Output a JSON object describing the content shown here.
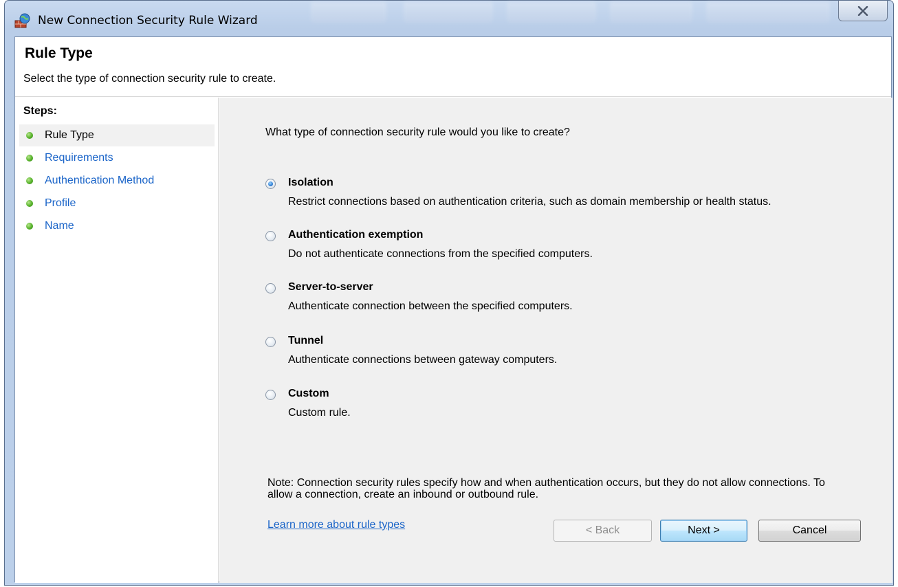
{
  "window": {
    "title": "New Connection Security Rule Wizard",
    "close_symbol": "✕"
  },
  "header": {
    "title": "Rule Type",
    "subtitle": "Select the type of connection security rule to create."
  },
  "steps": {
    "title": "Steps:",
    "items": [
      {
        "label": "Rule Type",
        "active": true
      },
      {
        "label": "Requirements",
        "active": false
      },
      {
        "label": "Authentication Method",
        "active": false
      },
      {
        "label": "Profile",
        "active": false
      },
      {
        "label": "Name",
        "active": false
      }
    ]
  },
  "main": {
    "question": "What type of connection security rule would you like to create?",
    "options": [
      {
        "label": "Isolation",
        "description": "Restrict connections based on authentication criteria, such as domain membership or health status.",
        "checked": true
      },
      {
        "label": "Authentication exemption",
        "description": "Do not authenticate connections from the specified computers.",
        "checked": false
      },
      {
        "label": "Server-to-server",
        "description": "Authenticate connection between the specified computers.",
        "checked": false
      },
      {
        "label": "Tunnel",
        "description": "Authenticate connections between gateway computers.",
        "checked": false
      },
      {
        "label": "Custom",
        "description": "Custom rule.",
        "checked": false
      }
    ],
    "note": "Note:  Connection security rules specify how and when authentication occurs, but they do not allow connections.  To allow a connection, create an inbound or outbound rule.",
    "learn_more": "Learn more about rule types"
  },
  "buttons": {
    "back": "< Back",
    "next": "Next >",
    "cancel": "Cancel"
  },
  "colors": {
    "link": "#1a64c8",
    "content_bg": "#f0f0f0",
    "step_dot": "#57b22b"
  }
}
